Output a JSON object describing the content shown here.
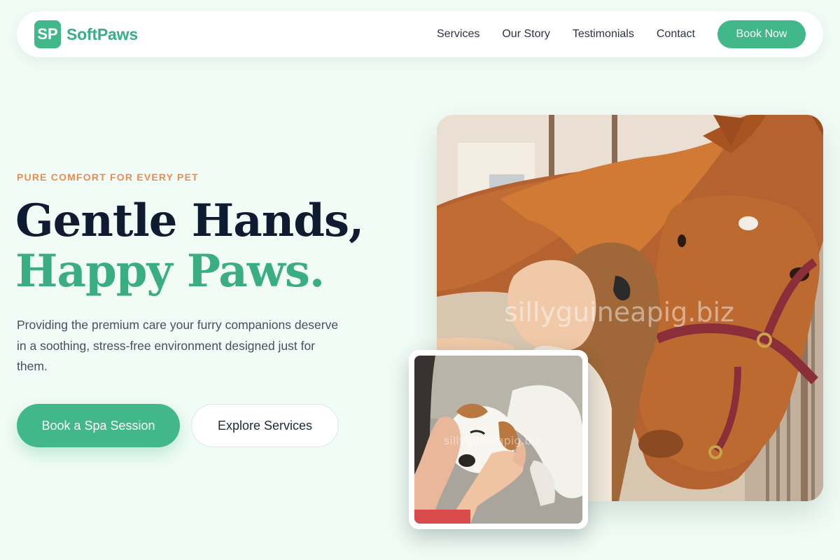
{
  "brand": {
    "mark": "SP",
    "name": "SoftPaws"
  },
  "nav": {
    "links": [
      "Services",
      "Our Story",
      "Testimonials",
      "Contact"
    ],
    "cta_label": "Book Now"
  },
  "hero": {
    "eyebrow": "PURE COMFORT FOR EVERY PET",
    "headline_line1": "Gentle Hands,",
    "headline_line2": "Happy Paws.",
    "description": "Providing the premium care your furry companions deserve in a soothing, stress-free environment designed just for them.",
    "primary_cta": "Book a Spa Session",
    "secondary_cta": "Explore Services"
  },
  "images": {
    "main_watermark": "sillyguineapig.biz",
    "inset_watermark": "sillyguineapig.biz"
  },
  "colors": {
    "accent": "#42b88a",
    "eyebrow": "#ef8a4f",
    "heading": "#0f1b31",
    "background": "#f2fcf7"
  }
}
